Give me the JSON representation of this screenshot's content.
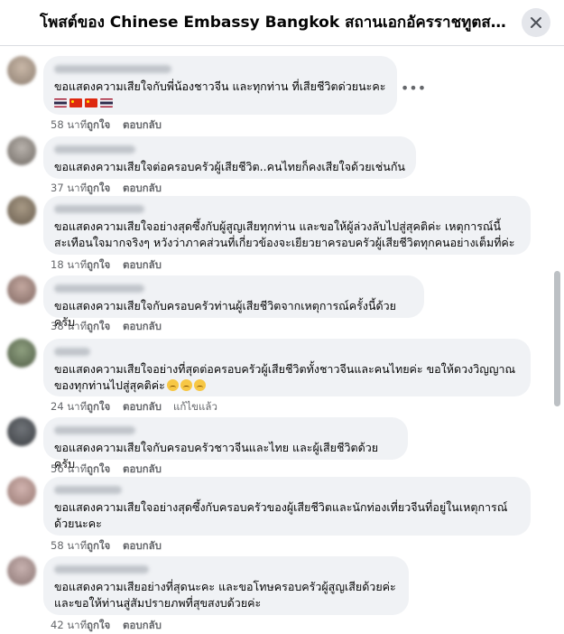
{
  "header": {
    "title": "โพสต์ของ Chinese Embassy Bangkok สถานเอกอัครราชทูตสา..."
  },
  "labels": {
    "like": "ถูกใจ",
    "reply": "ตอบกลับ"
  },
  "comments": [
    {
      "text": "ขอแสดงความเสียใจกับพี่น้องชาวจีน และทุกท่าน ที่เสียชีวิตด่วยนะคะ",
      "flags": [
        "th",
        "cn",
        "cn",
        "th"
      ],
      "time": "58 นาที"
    },
    {
      "text": "ขอแสดงความเสียใจต่อครอบครัวผู้เสียชีวิต..คนไทยก็คงเสียใจด้วยเช่นกัน",
      "time": "37 นาที"
    },
    {
      "text": "ขอแสดงความเสียใจอย่างสุดซึ้งกับผู้สูญเสียทุกท่าน และขอให้ผู้ล่วงลับไปสู่สุคติค่ะ เหตุการณ์นี้สะเทือนใจมากจริงๆ หวังว่าภาคส่วนที่เกี่ยวข้องจะเยียวยาครอบครัวผู้เสียชีวิตทุกคนอย่างเต็มที่ค่ะ",
      "time": "18 นาที"
    },
    {
      "text": "ขอแสดงความเสียใจกับครอบครัวท่านผู้เสียชีวิตจากเหตุการณ์ครั้งนี้ด้วยครับ",
      "time": "38 นาที"
    },
    {
      "text": "ขอแสดงความเสียใจอย่างที่สุดต่อครอบครัวผู้เสียชีวิตทั้งชาวจีนและคนไทยค่ะ ขอให้ดวงวิญญาณของทุกท่านไปสู่สุคติค่ะ",
      "emojis": 3,
      "time": "24 นาที",
      "edited": "แก้ไขแล้ว"
    },
    {
      "text": "ขอแสดงความเสียใจกับครอบครัวชาวจีนและไทย และผู้เสียชีวิตด้วยครับ",
      "time": "56 นาที"
    },
    {
      "text": "ขอแสดงความเสียใจอย่างสุดซึ้งกับครอบครัวของผู้เสียชีวิตและนักท่องเที่ยวจีนที่อยู่ในเหตุการณ์ด้วยนะคะ",
      "time": "58 นาที"
    },
    {
      "text": "ขอแสดงความเสียอย่างที่สุดนะคะ และขอโทษครอบครัวผู้สูญเสียด้วยค่ะ และขอให้ท่านสู่สัมปรายภพที่สุขสงบด้วยค่ะ",
      "time": "42 นาที"
    }
  ],
  "colors": {
    "bubble": "#f0f2f5",
    "meta": "#65676b",
    "accent": "#1877f2"
  }
}
